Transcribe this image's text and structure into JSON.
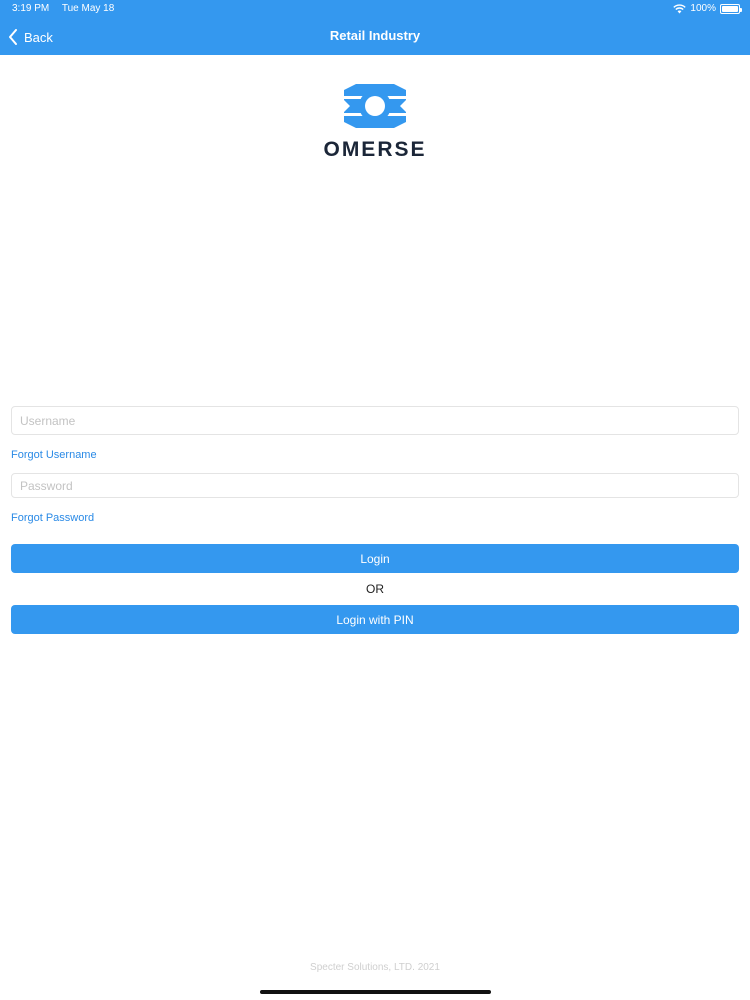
{
  "status_bar": {
    "time": "3:19 PM",
    "date": "Tue May 18",
    "battery": "100%",
    "battery_level": 1.0,
    "icons": [
      "wifi-icon",
      "battery-icon"
    ]
  },
  "nav": {
    "back_label": "Back",
    "title": "Retail Industry",
    "back_icon": "chevron-left-icon"
  },
  "logo": {
    "brand": "OMERSE",
    "mark_icon": "omerse-logo-mark"
  },
  "form": {
    "username_placeholder": "Username",
    "username_value": "",
    "forgot_username": "Forgot Username",
    "password_placeholder": "Password",
    "password_value": "",
    "forgot_password": "Forgot Password",
    "login_label": "Login",
    "or_label": "OR",
    "pin_login_label": "Login with PIN"
  },
  "footer": {
    "copyright": "Specter Solutions, LTD. 2021"
  },
  "colors": {
    "primary": "#3498ef",
    "link": "#2a8ae6",
    "brand_text": "#1b2638",
    "input_border": "#e4e4e4",
    "background": "#ffffff"
  }
}
